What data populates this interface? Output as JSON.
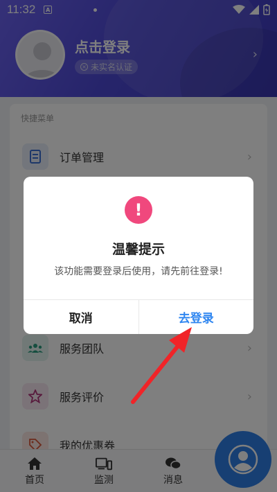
{
  "status_bar": {
    "time": "11:32",
    "notif": "A"
  },
  "header": {
    "login_text": "点击登录",
    "verify_badge": "未实名认证"
  },
  "menu": {
    "section_title": "快捷菜单",
    "items": [
      {
        "label": "订单管理",
        "icon": "document-icon"
      },
      {
        "label": "服务团队",
        "icon": "team-icon"
      },
      {
        "label": "服务评价",
        "icon": "star-icon"
      },
      {
        "label": "我的优惠券",
        "icon": "coupon-icon"
      }
    ]
  },
  "tabbar": {
    "tabs": [
      {
        "label": "首页",
        "icon": "home-icon"
      },
      {
        "label": "监测",
        "icon": "devices-icon"
      },
      {
        "label": "消息",
        "icon": "chat-icon"
      }
    ]
  },
  "dialog": {
    "title": "温馨提示",
    "message": "该功能需要登录后使用，请先前往登录!",
    "cancel_label": "取消",
    "confirm_label": "去登录",
    "accent_color": "#2f86f0",
    "alert_color": "#f0487d"
  }
}
